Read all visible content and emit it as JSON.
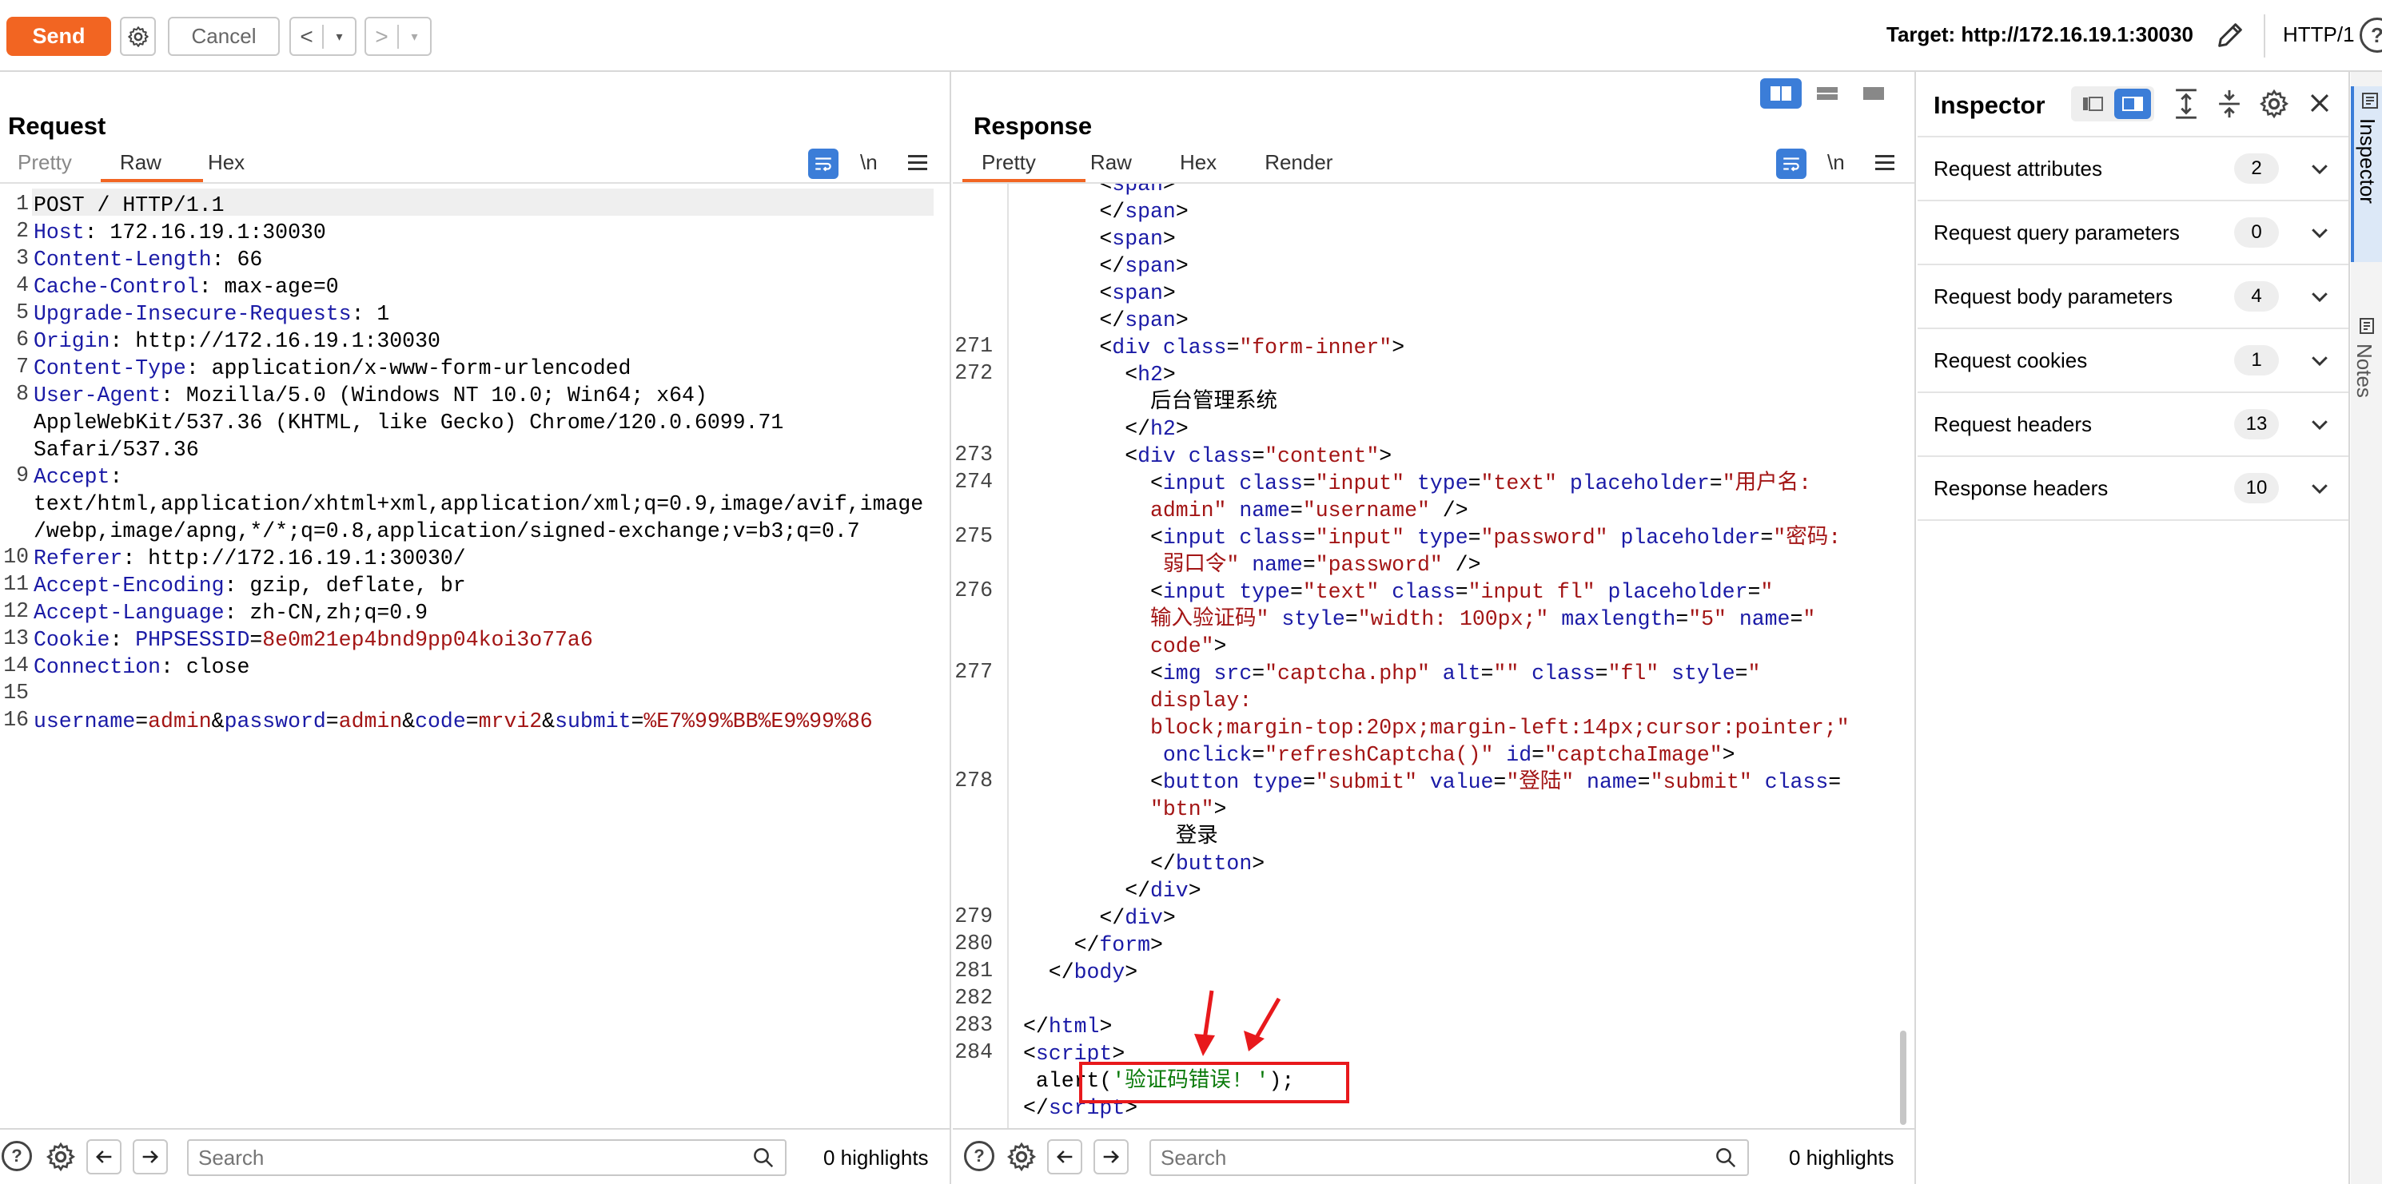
{
  "toolbar": {
    "send_label": "Send",
    "cancel_label": "Cancel",
    "back_glyph": "<",
    "fwd_glyph": ">",
    "dropdown_glyph": "▾",
    "target": "Target: http://172.16.19.1:30030",
    "protocol": "HTTP/1",
    "help_glyph": "?",
    "accent_color": "#f26522"
  },
  "request": {
    "title": "Request",
    "tabs": [
      "Pretty",
      "Raw",
      "Hex"
    ],
    "active_tab": "Raw",
    "newline_toggle": "\\n",
    "lines": [
      {
        "n": "1",
        "text": "POST / HTTP/1.1"
      },
      {
        "n": "2",
        "key": "Host",
        "val": " 172.16.19.1:30030"
      },
      {
        "n": "3",
        "key": "Content-Length",
        "val": " 66"
      },
      {
        "n": "4",
        "key": "Cache-Control",
        "val": " max-age=0"
      },
      {
        "n": "5",
        "key": "Upgrade-Insecure-Requests",
        "val": " 1"
      },
      {
        "n": "6",
        "key": "Origin",
        "val": " http://172.16.19.1:30030"
      },
      {
        "n": "7",
        "key": "Content-Type",
        "val": " application/x-www-form-urlencoded"
      },
      {
        "n": "8",
        "key": "User-Agent",
        "val": " Mozilla/5.0 (Windows NT 10.0; Win64; x64)"
      },
      {
        "n": "",
        "text": "AppleWebKit/537.36 (KHTML, like Gecko) Chrome/120.0.6099.71"
      },
      {
        "n": "",
        "text": "Safari/537.36"
      },
      {
        "n": "9",
        "key": "Accept",
        "val": ""
      },
      {
        "n": "",
        "text": "text/html,application/xhtml+xml,application/xml;q=0.9,image/avif,image"
      },
      {
        "n": "",
        "text": "/webp,image/apng,*/*;q=0.8,application/signed-exchange;v=b3;q=0.7"
      },
      {
        "n": "10",
        "key": "Referer",
        "val": " http://172.16.19.1:30030/"
      },
      {
        "n": "11",
        "key": "Accept-Encoding",
        "val": " gzip, deflate, br"
      },
      {
        "n": "12",
        "key": "Accept-Language",
        "val": " zh-CN,zh;q=0.9"
      },
      {
        "n": "13",
        "key": "Cookie",
        "cookie_name": "PHPSESSID",
        "cookie_val": "8e0m21ep4bnd9pp04koi3o77a6"
      },
      {
        "n": "14",
        "key": "Connection",
        "val": " close"
      },
      {
        "n": "15",
        "text": ""
      },
      {
        "n": "16",
        "body": [
          {
            "k": "username",
            "v": "admin"
          },
          {
            "k": "password",
            "v": "admin"
          },
          {
            "k": "code",
            "v": "mrvi2"
          },
          {
            "k": "submit",
            "v": "%E7%99%BB%E9%99%86"
          }
        ]
      }
    ],
    "search_placeholder": "Search",
    "highlights": "0 highlights"
  },
  "response": {
    "title": "Response",
    "tabs": [
      "Pretty",
      "Raw",
      "Hex",
      "Render"
    ],
    "active_tab": "Pretty",
    "newline_toggle": "\\n",
    "lines": [
      {
        "n": "",
        "indent": 6,
        "parts": [
          [
            "p",
            "<"
          ],
          [
            "t",
            "span"
          ],
          [
            "p",
            ">"
          ]
        ]
      },
      {
        "n": "",
        "indent": 6,
        "parts": [
          [
            "p",
            "</"
          ],
          [
            "t",
            "span"
          ],
          [
            "p",
            ">"
          ]
        ]
      },
      {
        "n": "",
        "indent": 6,
        "parts": [
          [
            "p",
            "<"
          ],
          [
            "t",
            "span"
          ],
          [
            "p",
            ">"
          ]
        ]
      },
      {
        "n": "",
        "indent": 6,
        "parts": [
          [
            "p",
            "</"
          ],
          [
            "t",
            "span"
          ],
          [
            "p",
            ">"
          ]
        ]
      },
      {
        "n": "",
        "indent": 6,
        "parts": [
          [
            "p",
            "<"
          ],
          [
            "t",
            "span"
          ],
          [
            "p",
            ">"
          ]
        ]
      },
      {
        "n": "",
        "indent": 6,
        "parts": [
          [
            "p",
            "</"
          ],
          [
            "t",
            "span"
          ],
          [
            "p",
            ">"
          ]
        ]
      },
      {
        "n": "271",
        "indent": 6,
        "parts": [
          [
            "p",
            "<"
          ],
          [
            "t",
            "div "
          ],
          [
            "a",
            "class"
          ],
          [
            "p",
            "="
          ],
          [
            "s",
            "\"form-inner\""
          ],
          [
            "p",
            ">"
          ]
        ]
      },
      {
        "n": "272",
        "indent": 8,
        "parts": [
          [
            "p",
            "<"
          ],
          [
            "t",
            "h2"
          ],
          [
            "p",
            ">"
          ]
        ]
      },
      {
        "n": "",
        "indent": 10,
        "parts": [
          [
            "p",
            "后台管理系统"
          ]
        ]
      },
      {
        "n": "",
        "indent": 8,
        "parts": [
          [
            "p",
            "</"
          ],
          [
            "t",
            "h2"
          ],
          [
            "p",
            ">"
          ]
        ]
      },
      {
        "n": "273",
        "indent": 8,
        "parts": [
          [
            "p",
            "<"
          ],
          [
            "t",
            "div "
          ],
          [
            "a",
            "class"
          ],
          [
            "p",
            "="
          ],
          [
            "s",
            "\"content\""
          ],
          [
            "p",
            ">"
          ]
        ]
      },
      {
        "n": "274",
        "indent": 10,
        "parts": [
          [
            "p",
            "<"
          ],
          [
            "t",
            "input "
          ],
          [
            "a",
            "class"
          ],
          [
            "p",
            "="
          ],
          [
            "s",
            "\"input\""
          ],
          [
            "p",
            " "
          ],
          [
            "a",
            "type"
          ],
          [
            "p",
            "="
          ],
          [
            "s",
            "\"text\""
          ],
          [
            "p",
            " "
          ],
          [
            "a",
            "placeholder"
          ],
          [
            "p",
            "="
          ],
          [
            "s",
            "\"用户名:"
          ]
        ]
      },
      {
        "n": "",
        "indent": 10,
        "parts": [
          [
            "s",
            "admin\""
          ],
          [
            "p",
            " "
          ],
          [
            "a",
            "name"
          ],
          [
            "p",
            "="
          ],
          [
            "s",
            "\"username\""
          ],
          [
            "p",
            " />"
          ]
        ]
      },
      {
        "n": "275",
        "indent": 10,
        "parts": [
          [
            "p",
            "<"
          ],
          [
            "t",
            "input "
          ],
          [
            "a",
            "class"
          ],
          [
            "p",
            "="
          ],
          [
            "s",
            "\"input\""
          ],
          [
            "p",
            " "
          ],
          [
            "a",
            "type"
          ],
          [
            "p",
            "="
          ],
          [
            "s",
            "\"password\""
          ],
          [
            "p",
            " "
          ],
          [
            "a",
            "placeholder"
          ],
          [
            "p",
            "="
          ],
          [
            "s",
            "\"密码:"
          ]
        ]
      },
      {
        "n": "",
        "indent": 10,
        "parts": [
          [
            "s",
            " 弱口令\""
          ],
          [
            "p",
            " "
          ],
          [
            "a",
            "name"
          ],
          [
            "p",
            "="
          ],
          [
            "s",
            "\"password\""
          ],
          [
            "p",
            " />"
          ]
        ]
      },
      {
        "n": "276",
        "indent": 10,
        "parts": [
          [
            "p",
            "<"
          ],
          [
            "t",
            "input "
          ],
          [
            "a",
            "type"
          ],
          [
            "p",
            "="
          ],
          [
            "s",
            "\"text\""
          ],
          [
            "p",
            " "
          ],
          [
            "a",
            "class"
          ],
          [
            "p",
            "="
          ],
          [
            "s",
            "\"input fl\""
          ],
          [
            "p",
            " "
          ],
          [
            "a",
            "placeholder"
          ],
          [
            "p",
            "="
          ],
          [
            "s",
            "\""
          ]
        ]
      },
      {
        "n": "",
        "indent": 10,
        "parts": [
          [
            "s",
            "输入验证码\""
          ],
          [
            "p",
            " "
          ],
          [
            "a",
            "style"
          ],
          [
            "p",
            "="
          ],
          [
            "s",
            "\"width: 100px;\""
          ],
          [
            "p",
            " "
          ],
          [
            "a",
            "maxlength"
          ],
          [
            "p",
            "="
          ],
          [
            "s",
            "\"5\""
          ],
          [
            "p",
            " "
          ],
          [
            "a",
            "name"
          ],
          [
            "p",
            "="
          ],
          [
            "s",
            "\""
          ]
        ]
      },
      {
        "n": "",
        "indent": 10,
        "parts": [
          [
            "s",
            "code\""
          ],
          [
            "p",
            ">"
          ]
        ]
      },
      {
        "n": "277",
        "indent": 10,
        "parts": [
          [
            "p",
            "<"
          ],
          [
            "t",
            "img "
          ],
          [
            "a",
            "src"
          ],
          [
            "p",
            "="
          ],
          [
            "s",
            "\"captcha.php\""
          ],
          [
            "p",
            " "
          ],
          [
            "a",
            "alt"
          ],
          [
            "p",
            "="
          ],
          [
            "s",
            "\"\""
          ],
          [
            "p",
            " "
          ],
          [
            "a",
            "class"
          ],
          [
            "p",
            "="
          ],
          [
            "s",
            "\"fl\""
          ],
          [
            "p",
            " "
          ],
          [
            "a",
            "style"
          ],
          [
            "p",
            "="
          ],
          [
            "s",
            "\""
          ]
        ]
      },
      {
        "n": "",
        "indent": 10,
        "parts": [
          [
            "s",
            "display:"
          ]
        ]
      },
      {
        "n": "",
        "indent": 10,
        "parts": [
          [
            "s",
            "block;margin-top:20px;margin-left:14px;cursor:pointer;\""
          ]
        ]
      },
      {
        "n": "",
        "indent": 10,
        "parts": [
          [
            "p",
            " "
          ],
          [
            "a",
            "onclick"
          ],
          [
            "p",
            "="
          ],
          [
            "s",
            "\"refreshCaptcha()\""
          ],
          [
            "p",
            " "
          ],
          [
            "a",
            "id"
          ],
          [
            "p",
            "="
          ],
          [
            "s",
            "\"captchaImage\""
          ],
          [
            "p",
            ">"
          ]
        ]
      },
      {
        "n": "278",
        "indent": 10,
        "parts": [
          [
            "p",
            "<"
          ],
          [
            "t",
            "button "
          ],
          [
            "a",
            "type"
          ],
          [
            "p",
            "="
          ],
          [
            "s",
            "\"submit\""
          ],
          [
            "p",
            " "
          ],
          [
            "a",
            "value"
          ],
          [
            "p",
            "="
          ],
          [
            "s",
            "\"登陆\""
          ],
          [
            "p",
            " "
          ],
          [
            "a",
            "name"
          ],
          [
            "p",
            "="
          ],
          [
            "s",
            "\"submit\""
          ],
          [
            "p",
            " "
          ],
          [
            "a",
            "class"
          ],
          [
            "p",
            "="
          ]
        ]
      },
      {
        "n": "",
        "indent": 10,
        "parts": [
          [
            "s",
            "\"btn\""
          ],
          [
            "p",
            ">"
          ]
        ]
      },
      {
        "n": "",
        "indent": 12,
        "parts": [
          [
            "p",
            "登录"
          ]
        ]
      },
      {
        "n": "",
        "indent": 10,
        "parts": [
          [
            "p",
            "</"
          ],
          [
            "t",
            "button"
          ],
          [
            "p",
            ">"
          ]
        ]
      },
      {
        "n": "",
        "indent": 8,
        "parts": [
          [
            "p",
            "</"
          ],
          [
            "t",
            "div"
          ],
          [
            "p",
            ">"
          ]
        ]
      },
      {
        "n": "279",
        "indent": 6,
        "parts": [
          [
            "p",
            "</"
          ],
          [
            "t",
            "div"
          ],
          [
            "p",
            ">"
          ]
        ]
      },
      {
        "n": "280",
        "indent": 4,
        "parts": [
          [
            "p",
            "</"
          ],
          [
            "t",
            "form"
          ],
          [
            "p",
            ">"
          ]
        ]
      },
      {
        "n": "281",
        "indent": 2,
        "parts": [
          [
            "p",
            "</"
          ],
          [
            "t",
            "body"
          ],
          [
            "p",
            ">"
          ]
        ]
      },
      {
        "n": "282",
        "indent": 0,
        "parts": []
      },
      {
        "n": "283",
        "indent": 0,
        "parts": [
          [
            "p",
            "</"
          ],
          [
            "t",
            "html"
          ],
          [
            "p",
            ">"
          ]
        ]
      },
      {
        "n": "284",
        "indent": 0,
        "parts": [
          [
            "p",
            "<"
          ],
          [
            "t",
            "script"
          ],
          [
            "p",
            ">"
          ]
        ]
      },
      {
        "n": "",
        "indent": 1,
        "parts": [
          [
            "p",
            "alert("
          ],
          [
            "j",
            "'验证码错误! '"
          ],
          [
            "p",
            ");"
          ]
        ]
      },
      {
        "n": "",
        "indent": 0,
        "parts": [
          [
            "p",
            "</"
          ],
          [
            "t",
            "script"
          ],
          [
            "p",
            ">"
          ]
        ]
      }
    ],
    "search_placeholder": "Search",
    "highlights": "0 highlights"
  },
  "inspector": {
    "title": "Inspector",
    "rows": [
      {
        "label": "Request attributes",
        "count": "2"
      },
      {
        "label": "Request query parameters",
        "count": "0"
      },
      {
        "label": "Request body parameters",
        "count": "4"
      },
      {
        "label": "Request cookies",
        "count": "1"
      },
      {
        "label": "Request headers",
        "count": "13"
      },
      {
        "label": "Response headers",
        "count": "10"
      }
    ]
  },
  "side_tabs": [
    "Inspector",
    "Notes"
  ],
  "colors": {
    "key_blue": "#1a1aa6",
    "value_red": "#a31515",
    "js_green": "#0a7a0a",
    "toggle_blue": "#3b7dd8",
    "annotation_red": "#e8191c"
  }
}
